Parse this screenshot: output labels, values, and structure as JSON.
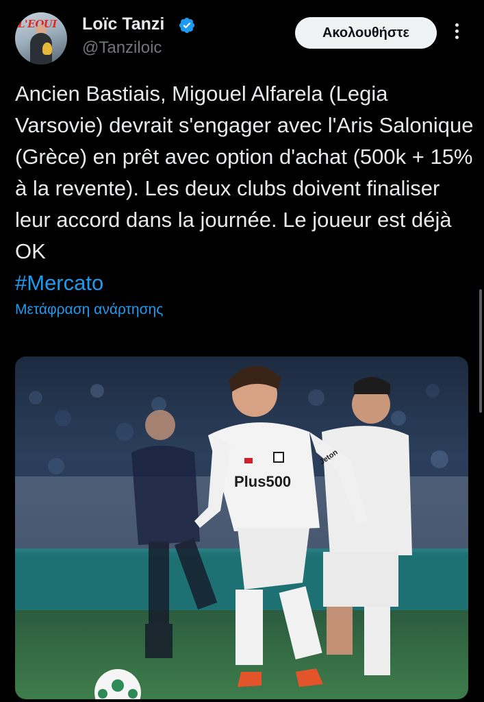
{
  "author": {
    "name": "Loïc Tanzi",
    "handle": "@Tanziloic",
    "avatar_logo_text": "L'EQUI"
  },
  "follow_button": {
    "label": "Ακολουθήστε"
  },
  "tweet": {
    "text": "Ancien Bastiais,  Migouel Alfarela (Legia Varsovie) devrait s'engager avec l'Aris Salonique (Grèce) en prêt avec option d'achat (500k + 15% à la revente). Les deux clubs doivent finaliser leur accord dans la journée. Le joueur est déjà OK",
    "hashtag": "#Mercato",
    "translate_label": "Μετάφραση ανάρτησης"
  },
  "media": {
    "shirt_sponsor": "Plus500",
    "sleeve_sponsor": "Jeton"
  },
  "colors": {
    "background": "#000000",
    "link": "#1d9bf0",
    "text": "#e7e9ea",
    "secondary_text": "#71767b",
    "verified": "#1d9bf0"
  },
  "icons": {
    "verified": "verified-badge-icon",
    "more": "more-vertical-icon"
  }
}
